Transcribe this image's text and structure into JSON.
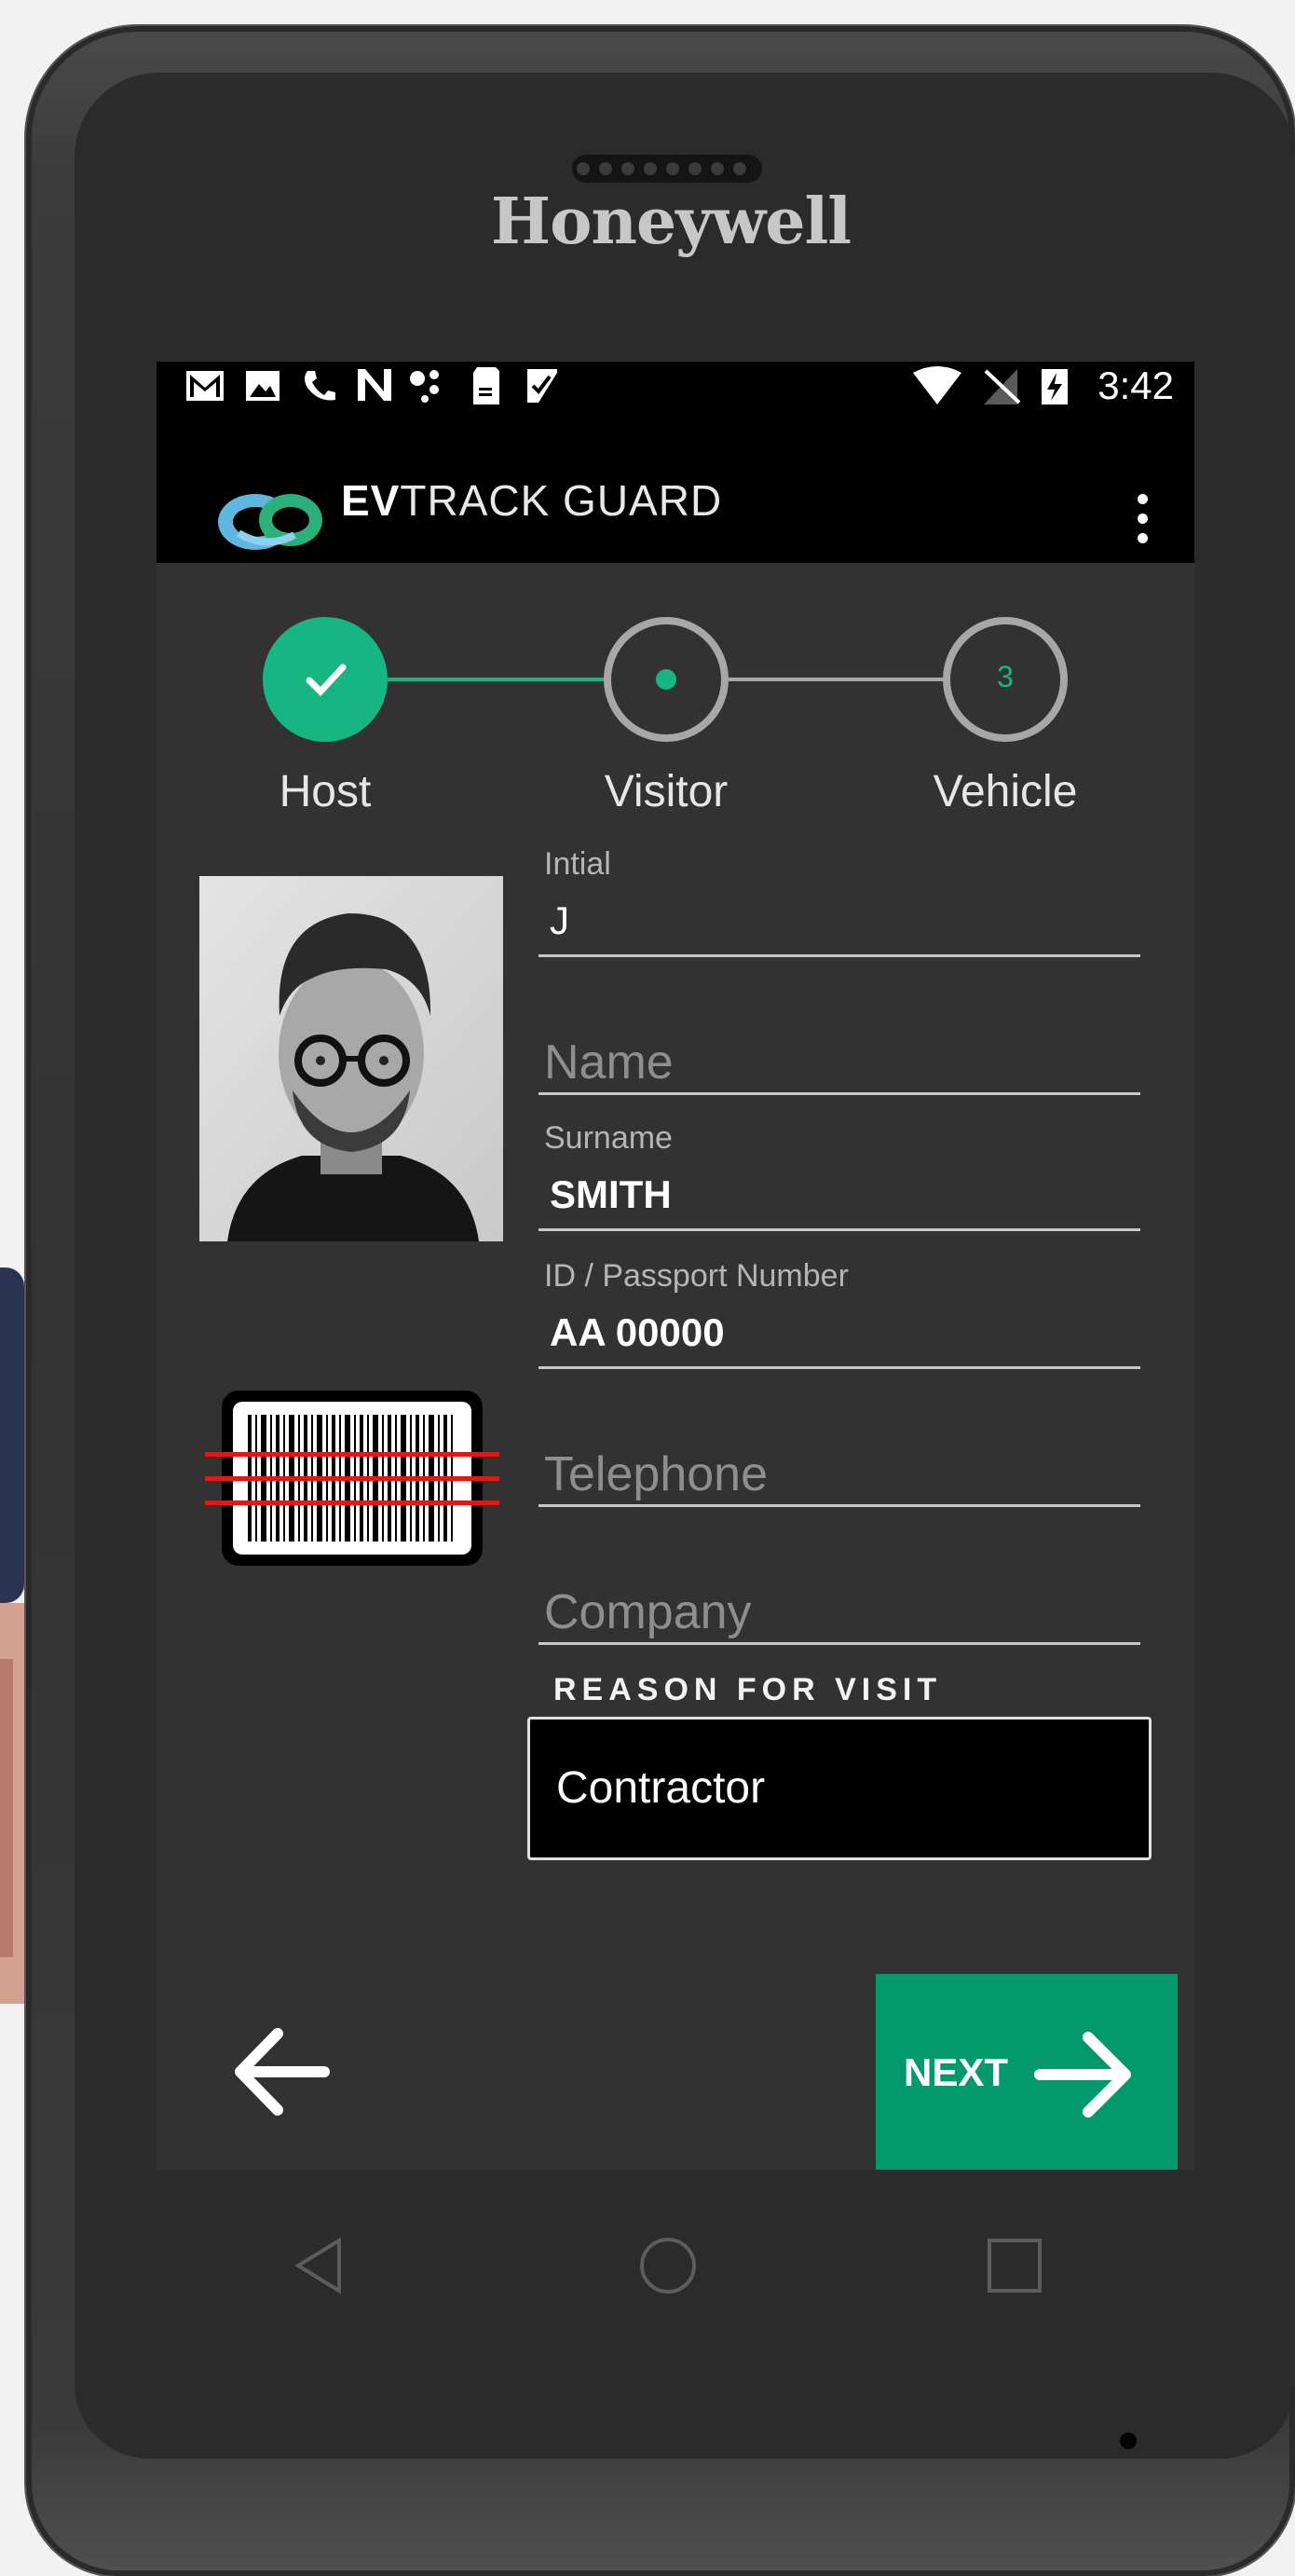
{
  "device": {
    "brand": "Honeywell"
  },
  "status_bar": {
    "time": "3:42",
    "icons": [
      "gmail-icon",
      "image-icon",
      "phone-icon",
      "n-icon",
      "dots-icon",
      "sd-card-icon",
      "check-clipboard-icon",
      "wifi-icon",
      "no-signal-icon",
      "battery-charging-icon"
    ]
  },
  "app_bar": {
    "logo_bold": "EV",
    "logo_text": "TRACK GUARD",
    "menu_icon": "more-vert-icon"
  },
  "stepper": {
    "steps": [
      {
        "label": "Host",
        "state": "done",
        "indicator": "check-icon"
      },
      {
        "label": "Visitor",
        "state": "current",
        "indicator": "dot-icon"
      },
      {
        "label": "Vehicle",
        "state": "pending",
        "indicator": "3"
      }
    ],
    "accent_color": "#17b582",
    "inactive_color": "#a7a7a7"
  },
  "form": {
    "initial": {
      "label": "Intial",
      "value": "J"
    },
    "name": {
      "placeholder": "Name"
    },
    "surname": {
      "label": "Surname",
      "value": "SMITH"
    },
    "id_number": {
      "label": "ID / Passport Number",
      "value": "AA 00000"
    },
    "telephone": {
      "placeholder": "Telephone"
    },
    "company": {
      "placeholder": "Company"
    },
    "reason": {
      "label": "REASON FOR VISIT",
      "value": "Contractor"
    }
  },
  "actions": {
    "back_icon": "arrow-left-icon",
    "next_label": "NEXT",
    "next_icon": "arrow-right-icon",
    "next_color": "#04996a"
  },
  "system_nav": [
    "back-triangle-icon",
    "home-circle-icon",
    "recents-square-icon"
  ]
}
